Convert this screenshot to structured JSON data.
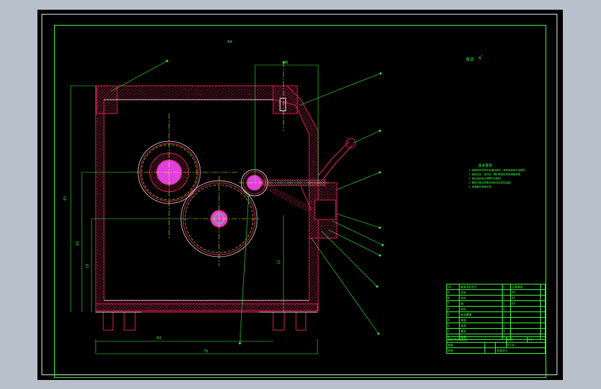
{
  "drawing": {
    "sheet_label": "A4",
    "roughness_label": "其余",
    "roughness_symbol": "√",
    "dims": {
      "top_width": "98",
      "bottom_width": "75",
      "bottom_inner": "83",
      "height_left": "83",
      "height_mid": "65",
      "height_low": "19",
      "height_right": "22"
    },
    "notes": {
      "title": "技术要求",
      "lines": [
        "1. 装配前所有零件用煤油清洗，滚动轴承用汽油清洗。",
        "2. 各配合处、密封处、螺钉联接处用润滑脂润滑。",
        "3. 保证齿轮啮合侧隙符合要求。",
        "4. 箱体内装全损耗系统用油至规定高度。",
        "5. 减速器外表面涂漆。"
      ]
    },
    "bom_rows": [
      [
        "10",
        "箱体密封垫片",
        "1",
        "石棉橡胶",
        ""
      ],
      [
        "9",
        "齿轮",
        "1",
        "45",
        ""
      ],
      [
        "8",
        "齿轮",
        "1",
        "45",
        ""
      ],
      [
        "7",
        "轴",
        "1",
        "45",
        ""
      ],
      [
        "6",
        "油标",
        "1",
        "",
        ""
      ],
      [
        "5",
        "放油螺塞",
        "1",
        "",
        ""
      ],
      [
        "4",
        "端盖",
        "1",
        "",
        ""
      ],
      [
        "3",
        "轴承",
        "2",
        "",
        ""
      ],
      [
        "2",
        "螺栓",
        "4",
        "",
        ""
      ],
      [
        "1",
        "箱体",
        "1",
        "",
        ""
      ]
    ],
    "title_block": {
      "name": "齿轮传动装配图",
      "scale_label": "比例",
      "scale": "1:1",
      "sheet": "共1张",
      "drawn": "制图",
      "checked": "审核",
      "company": "机械设计"
    }
  }
}
